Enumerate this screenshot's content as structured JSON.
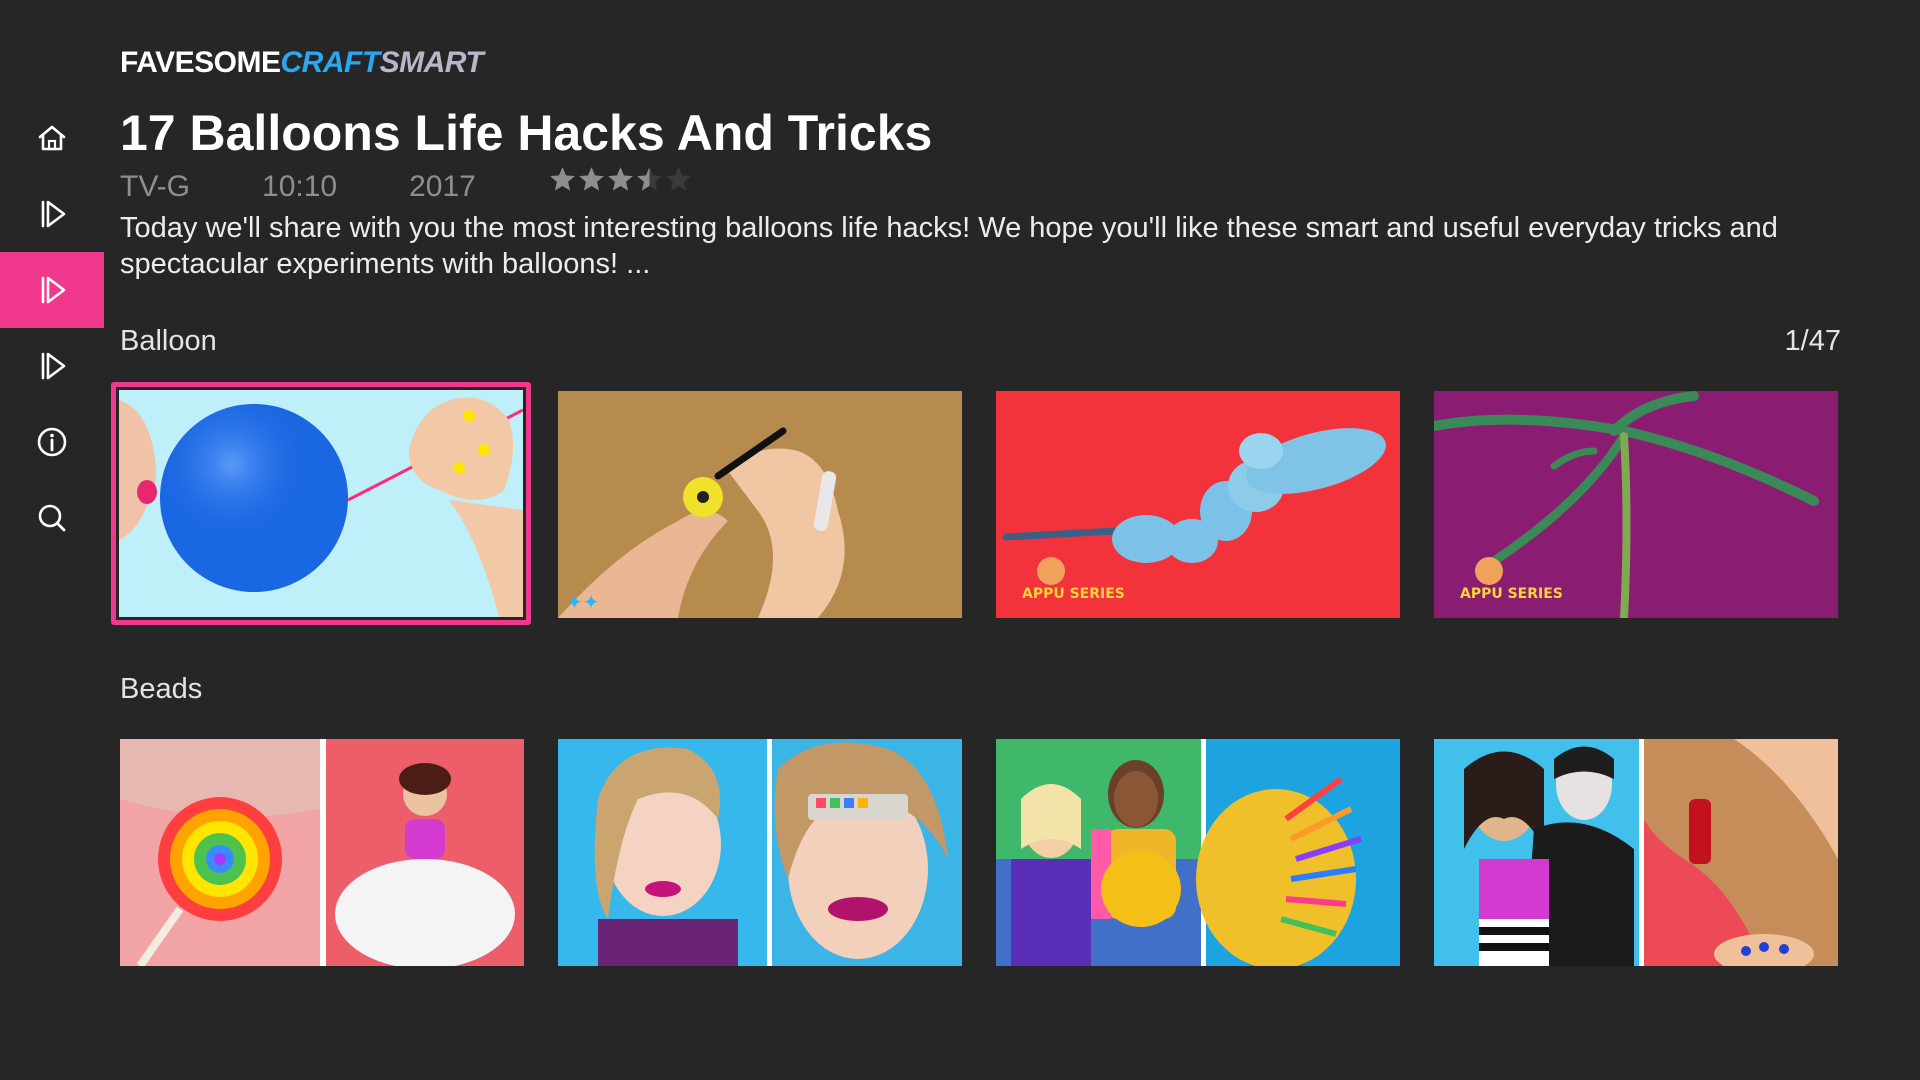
{
  "brand": {
    "part1": "FAVESOME",
    "part2": "CRAFT",
    "part3": "SMART"
  },
  "sidebar": {
    "items": [
      {
        "icon": "home-icon"
      },
      {
        "icon": "play-icon"
      },
      {
        "icon": "play-icon",
        "active": true
      },
      {
        "icon": "play-icon"
      },
      {
        "icon": "info-icon"
      },
      {
        "icon": "search-icon"
      }
    ],
    "accent_color": "#f0398c"
  },
  "video": {
    "title": "17 Balloons Life Hacks And Tricks",
    "rating": "TV-G",
    "duration": "10:10",
    "year": "2017",
    "stars": 3.5,
    "stars_max": 5,
    "description": "Today we'll share with you the most interesting balloons life hacks! We hope you'll like these smart and useful everyday tricks and spectacular experiments with balloons!  ..."
  },
  "rows": [
    {
      "label": "Balloon",
      "count": "1/47",
      "items": [
        {
          "name": "balloon-blow-thumbnail",
          "selected": true
        },
        {
          "name": "balloon-drawing-thumbnail"
        },
        {
          "name": "balloon-dog-thumbnail"
        },
        {
          "name": "balloon-tree-thumbnail"
        }
      ]
    },
    {
      "label": "Beads",
      "items": [
        {
          "name": "lollipop-thumbnail"
        },
        {
          "name": "makeup-thumbnail"
        },
        {
          "name": "pregnant-hack-thumbnail"
        },
        {
          "name": "vampire-thumbnail"
        }
      ]
    }
  ]
}
